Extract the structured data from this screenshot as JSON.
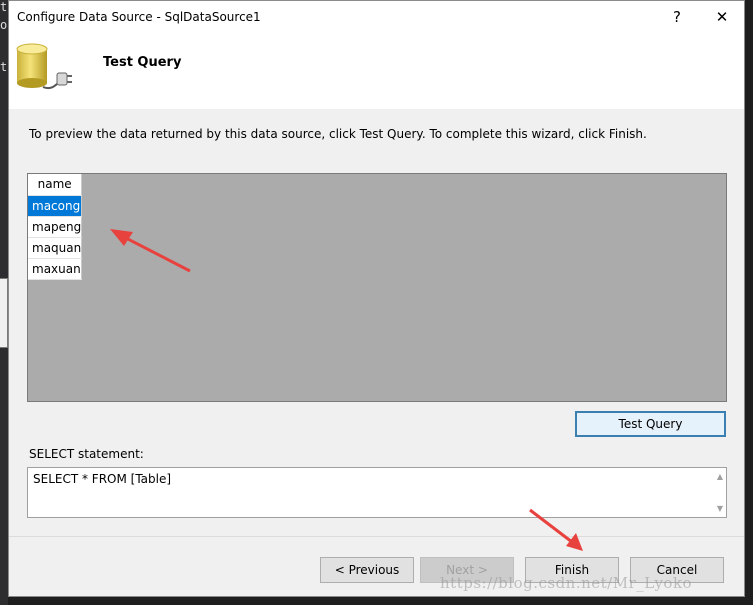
{
  "window": {
    "title": "Configure Data Source - SqlDataSource1",
    "help_glyph": "?",
    "close_glyph": "✕"
  },
  "header": {
    "title": "Test Query",
    "icon": "database-plug-icon"
  },
  "instructions": "To preview the data returned by this data source, click Test Query. To complete this wizard, click Finish.",
  "grid": {
    "columns": [
      "name"
    ],
    "rows": [
      "macong",
      "mapeng",
      "maquan",
      "maxuan"
    ],
    "selected_row": 0
  },
  "buttons": {
    "test_query": "Test Query",
    "previous": "< Previous",
    "next": "Next >",
    "finish": "Finish",
    "cancel": "Cancel"
  },
  "sql": {
    "label": "SELECT statement:",
    "statement": "SELECT * FROM [Table]"
  },
  "watermark": "https://blog.csdn.net/Mr_Lyoko",
  "background_glyphs": [
    "t",
    "o",
    "t"
  ],
  "colors": {
    "selection": "#0078d7",
    "grid_bg": "#ababab",
    "arrow": "#e8423f",
    "focus_border": "#3c7fb1"
  }
}
